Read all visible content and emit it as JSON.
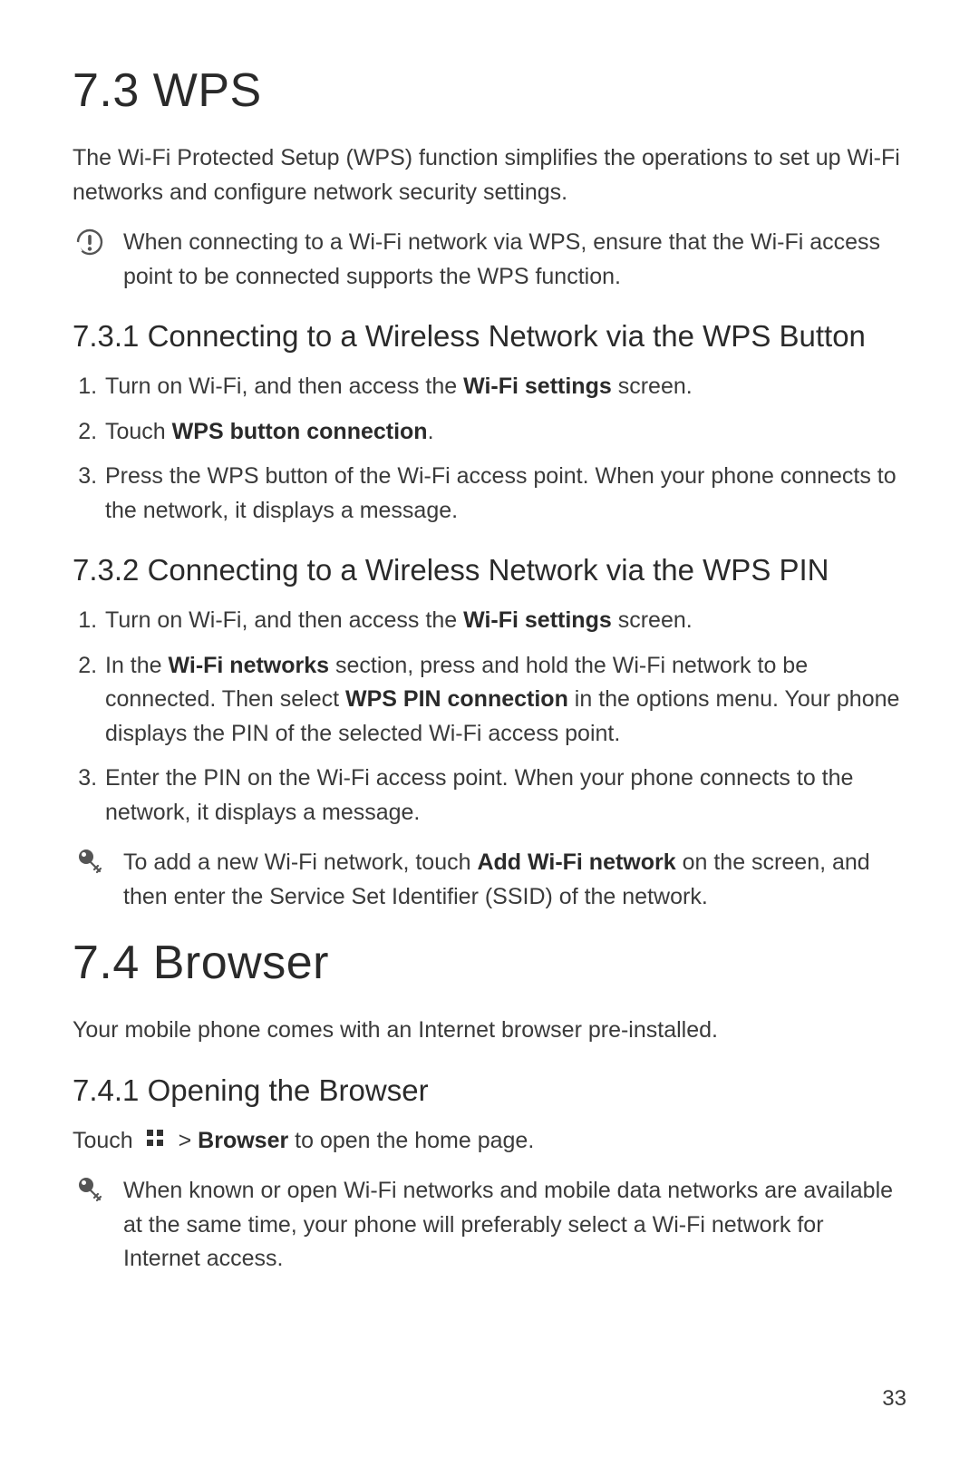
{
  "page_number": "33",
  "sec73": {
    "heading": "7.3  WPS",
    "intro": "The Wi-Fi Protected Setup (WPS) function simplifies the operations to set up Wi-Fi networks and configure network security settings.",
    "note1": "When connecting to a Wi-Fi network via WPS, ensure that the Wi-Fi access point to be connected supports the WPS function.",
    "sub1": {
      "heading": "7.3.1  Connecting to a Wireless Network via the WPS Button",
      "steps": [
        {
          "pre": "Turn on Wi-Fi, and then access the ",
          "bold": "Wi-Fi settings",
          "post": " screen."
        },
        {
          "pre": "Touch ",
          "bold": "WPS button connection",
          "post": "."
        },
        {
          "pre": "Press the WPS button of the Wi-Fi access point. When your phone connects to the network, it displays a message.",
          "bold": "",
          "post": ""
        }
      ]
    },
    "sub2": {
      "heading": "7.3.2  Connecting to a Wireless Network via the WPS PIN",
      "steps": [
        {
          "pre": "Turn on Wi-Fi, and then access the ",
          "bold": "Wi-Fi settings",
          "post": " screen."
        },
        {
          "pre": "In the ",
          "bold": "Wi-Fi networks",
          "post": " section, press and hold the Wi-Fi network to be connected. Then select ",
          "bold2": "WPS PIN connection",
          "post2": " in the options menu. Your phone displays the PIN of the selected Wi-Fi access point."
        },
        {
          "pre": "Enter the PIN on the Wi-Fi access point. When your phone connects to the network, it displays a message.",
          "bold": "",
          "post": ""
        }
      ]
    },
    "note2_pre": "To add a new Wi-Fi network, touch ",
    "note2_bold": "Add Wi-Fi network",
    "note2_post": " on the screen, and then enter the Service Set Identifier (SSID) of the network."
  },
  "sec74": {
    "heading": "7.4  Browser",
    "intro": "Your mobile phone comes with an Internet browser pre-installed.",
    "sub1": {
      "heading": "7.4.1  Opening the Browser",
      "touch_pre": "Touch ",
      "touch_sep": "  > ",
      "touch_bold": "Browser",
      "touch_post": " to open the home page.",
      "note": "When known or open Wi-Fi networks and mobile data networks are available at the same time, your phone will preferably select a Wi-Fi network for Internet access."
    }
  }
}
